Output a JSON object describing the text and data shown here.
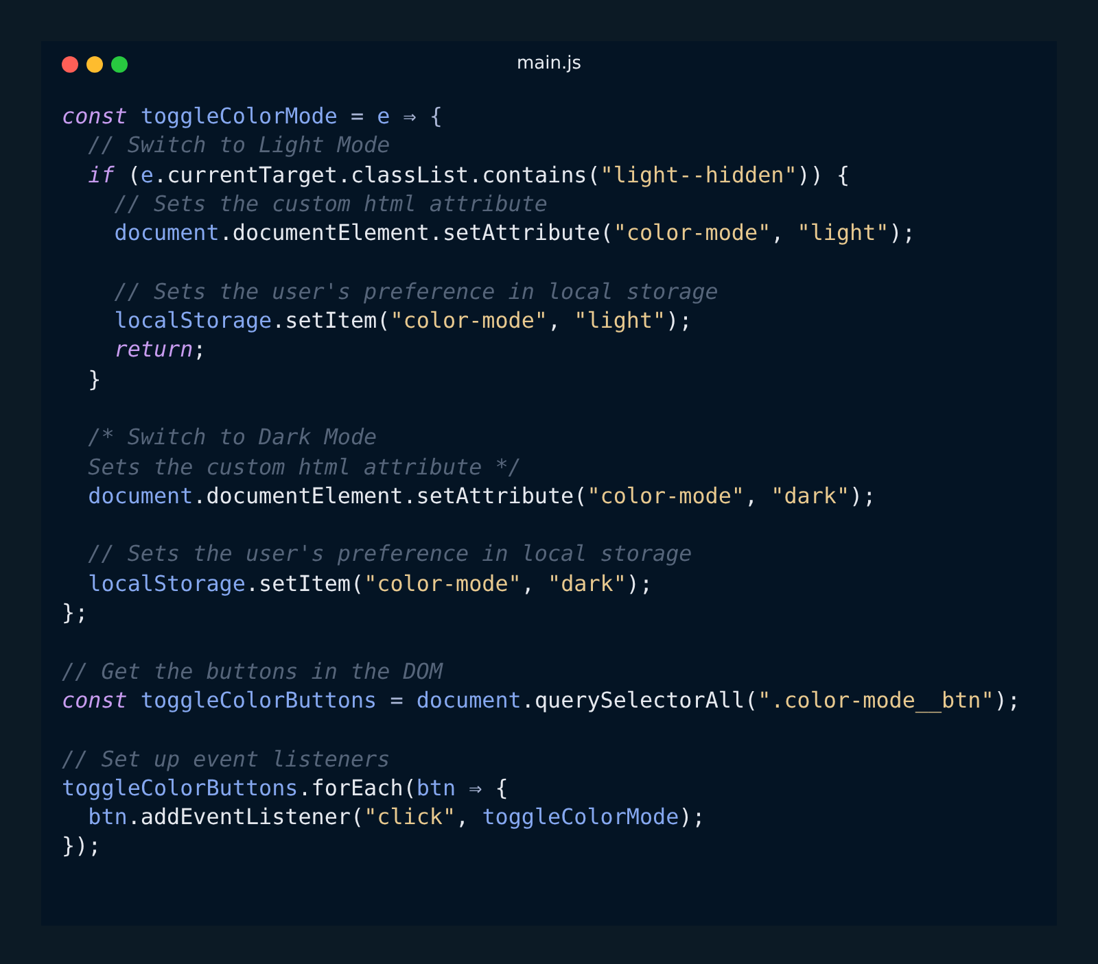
{
  "window": {
    "title": "main.js"
  },
  "code_lines": [
    {
      "kind": "code",
      "tokens": [
        {
          "kind": "keyword",
          "text": "const "
        },
        {
          "kind": "variable",
          "text": "toggleColorMode"
        },
        {
          "kind": "operator",
          "text": " = "
        },
        {
          "kind": "variable",
          "text": "e"
        },
        {
          "kind": "operator",
          "text": " ⇒ {"
        }
      ]
    },
    {
      "kind": "code",
      "tokens": [
        {
          "kind": "comment",
          "text": "  // Switch to Light Mode"
        }
      ]
    },
    {
      "kind": "code",
      "tokens": [
        {
          "kind": "keyword",
          "text": "  if"
        },
        {
          "kind": "plain",
          "text": " ("
        },
        {
          "kind": "variable",
          "text": "e"
        },
        {
          "kind": "plain",
          "text": ".currentTarget.classList.contains("
        },
        {
          "kind": "string",
          "text": "\"light--hidden\""
        },
        {
          "kind": "plain",
          "text": ")) {"
        }
      ]
    },
    {
      "kind": "code",
      "tokens": [
        {
          "kind": "comment",
          "text": "    // Sets the custom html attribute"
        }
      ]
    },
    {
      "kind": "code",
      "tokens": [
        {
          "kind": "variable",
          "text": "    document"
        },
        {
          "kind": "plain",
          "text": ".documentElement.setAttribute("
        },
        {
          "kind": "string",
          "text": "\"color-mode\""
        },
        {
          "kind": "plain",
          "text": ", "
        },
        {
          "kind": "string",
          "text": "\"light\""
        },
        {
          "kind": "plain",
          "text": ");"
        }
      ]
    },
    {
      "kind": "blank"
    },
    {
      "kind": "code",
      "tokens": [
        {
          "kind": "comment",
          "text": "    // Sets the user's preference in local storage"
        }
      ]
    },
    {
      "kind": "code",
      "tokens": [
        {
          "kind": "variable",
          "text": "    localStorage"
        },
        {
          "kind": "plain",
          "text": ".setItem("
        },
        {
          "kind": "string",
          "text": "\"color-mode\""
        },
        {
          "kind": "plain",
          "text": ", "
        },
        {
          "kind": "string",
          "text": "\"light\""
        },
        {
          "kind": "plain",
          "text": ");"
        }
      ]
    },
    {
      "kind": "code",
      "tokens": [
        {
          "kind": "keyword",
          "text": "    return"
        },
        {
          "kind": "plain",
          "text": ";"
        }
      ]
    },
    {
      "kind": "code",
      "tokens": [
        {
          "kind": "plain",
          "text": "  }"
        }
      ]
    },
    {
      "kind": "blank"
    },
    {
      "kind": "code",
      "tokens": [
        {
          "kind": "comment",
          "text": "  /* Switch to Dark Mode"
        }
      ]
    },
    {
      "kind": "code",
      "tokens": [
        {
          "kind": "comment",
          "text": "  Sets the custom html attribute */"
        }
      ]
    },
    {
      "kind": "code",
      "tokens": [
        {
          "kind": "variable",
          "text": "  document"
        },
        {
          "kind": "plain",
          "text": ".documentElement.setAttribute("
        },
        {
          "kind": "string",
          "text": "\"color-mode\""
        },
        {
          "kind": "plain",
          "text": ", "
        },
        {
          "kind": "string",
          "text": "\"dark\""
        },
        {
          "kind": "plain",
          "text": ");"
        }
      ]
    },
    {
      "kind": "blank"
    },
    {
      "kind": "code",
      "tokens": [
        {
          "kind": "comment",
          "text": "  // Sets the user's preference in local storage"
        }
      ]
    },
    {
      "kind": "code",
      "tokens": [
        {
          "kind": "variable",
          "text": "  localStorage"
        },
        {
          "kind": "plain",
          "text": ".setItem("
        },
        {
          "kind": "string",
          "text": "\"color-mode\""
        },
        {
          "kind": "plain",
          "text": ", "
        },
        {
          "kind": "string",
          "text": "\"dark\""
        },
        {
          "kind": "plain",
          "text": ");"
        }
      ]
    },
    {
      "kind": "code",
      "tokens": [
        {
          "kind": "plain",
          "text": "};"
        }
      ]
    },
    {
      "kind": "blank"
    },
    {
      "kind": "code",
      "tokens": [
        {
          "kind": "comment",
          "text": "// Get the buttons in the DOM"
        }
      ]
    },
    {
      "kind": "code",
      "tokens": [
        {
          "kind": "keyword",
          "text": "const "
        },
        {
          "kind": "variable",
          "text": "toggleColorButtons"
        },
        {
          "kind": "operator",
          "text": " = "
        },
        {
          "kind": "variable",
          "text": "document"
        },
        {
          "kind": "plain",
          "text": ".querySelectorAll("
        },
        {
          "kind": "string",
          "text": "\".color-mode__btn\""
        },
        {
          "kind": "plain",
          "text": ");"
        }
      ]
    },
    {
      "kind": "blank"
    },
    {
      "kind": "code",
      "tokens": [
        {
          "kind": "comment",
          "text": "// Set up event listeners"
        }
      ]
    },
    {
      "kind": "code",
      "tokens": [
        {
          "kind": "variable",
          "text": "toggleColorButtons"
        },
        {
          "kind": "plain",
          "text": ".forEach("
        },
        {
          "kind": "variable",
          "text": "btn"
        },
        {
          "kind": "operator",
          "text": " ⇒ "
        },
        {
          "kind": "plain",
          "text": "{"
        }
      ]
    },
    {
      "kind": "code",
      "tokens": [
        {
          "kind": "variable",
          "text": "  btn"
        },
        {
          "kind": "plain",
          "text": ".addEventListener("
        },
        {
          "kind": "string",
          "text": "\"click\""
        },
        {
          "kind": "plain",
          "text": ", "
        },
        {
          "kind": "variable",
          "text": "toggleColorMode"
        },
        {
          "kind": "plain",
          "text": ");"
        }
      ]
    },
    {
      "kind": "code",
      "tokens": [
        {
          "kind": "plain",
          "text": "});"
        }
      ]
    }
  ]
}
